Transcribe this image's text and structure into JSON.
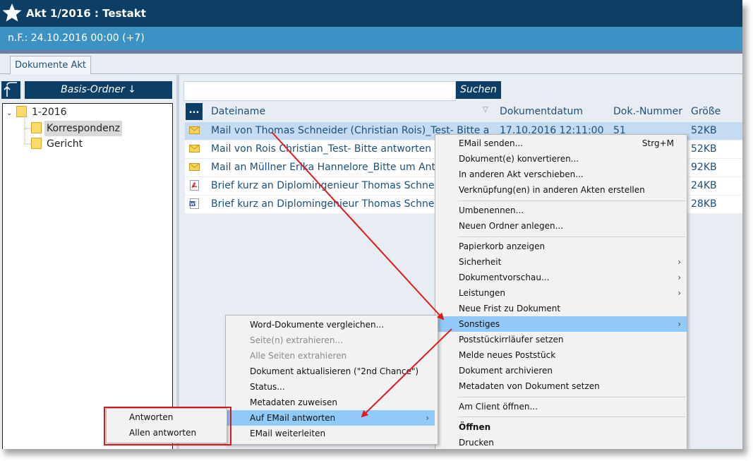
{
  "window": {
    "title": "Akt 1/2016 : Testakt",
    "subtitle": "n.F.: 24.10.2016 00:00 (+7)",
    "tab": "Dokumente Akt"
  },
  "left": {
    "basis_label": "Basis-Ordner ↓",
    "tree": [
      {
        "label": "1-2016",
        "expanded": true
      },
      {
        "label": "Korrespondenz",
        "selected": true
      },
      {
        "label": "Gericht"
      }
    ]
  },
  "search": {
    "value": "",
    "button": "Suchen"
  },
  "table": {
    "dots": "...",
    "columns": [
      "Dateiname",
      "Dokumentdatum",
      "Dok.-Nummer",
      "Größe"
    ],
    "rows": [
      {
        "icon": "email-icon",
        "name": "Mail von Thomas Schneider (Christian Rois)_Test- Bitte a",
        "date": "17.10.2016 12:11:00",
        "num": "51",
        "size": "52KB"
      },
      {
        "icon": "email-icon",
        "name": "Mail von Rois Christian_Test- Bitte antworten [",
        "date": "",
        "num": "",
        "size": "52KB"
      },
      {
        "icon": "email-icon",
        "name": "Mail an Müllner Erika Hannelore_Bitte um Ant",
        "date": "",
        "num": "",
        "size": "92KB"
      },
      {
        "icon": "pdf-icon",
        "name": "Brief kurz an Diplomingenieur Thomas Schnei",
        "date": "",
        "num": "",
        "size": "24KB"
      },
      {
        "icon": "word-icon",
        "name": "Brief kurz an Diplomingenieur Thomas Schnei",
        "date": "",
        "num": "",
        "size": "28KB"
      }
    ]
  },
  "context_menu": {
    "items": [
      {
        "label": "EMail senden...",
        "shortcut": "Strg+M"
      },
      {
        "label": "Dokument(e) konvertieren..."
      },
      {
        "label": "In anderen Akt verschieben..."
      },
      {
        "label": "Verknüpfung(en) in anderen Akten erstellen"
      },
      {
        "label": "Umbenennen..."
      },
      {
        "label": "Neuen Ordner anlegen..."
      },
      {
        "label": "Papierkorb anzeigen"
      },
      {
        "label": "Sicherheit",
        "submenu": true
      },
      {
        "label": "Dokumentvorschau...",
        "submenu": true
      },
      {
        "label": "Leistungen",
        "submenu": true
      },
      {
        "label": "Neue Frist zu Dokument"
      },
      {
        "label": "Sonstiges",
        "submenu": true,
        "highlighted": true
      },
      {
        "label": "Poststückirrläufer setzen"
      },
      {
        "label": "Melde neues Poststück"
      },
      {
        "label": "Dokument archivieren"
      },
      {
        "label": "Metadaten von Dokument setzen"
      },
      {
        "label": "Am Client öffnen..."
      },
      {
        "label": "Öffnen",
        "bold": true
      },
      {
        "label": "Drucken"
      }
    ]
  },
  "sonstiges_menu": {
    "items": [
      {
        "label": "Word-Dokumente vergleichen..."
      },
      {
        "label": "Seite(n) extrahieren...",
        "disabled": true
      },
      {
        "label": "Alle Seiten extrahieren",
        "disabled": true
      },
      {
        "label": "Dokument aktualisieren (\"2nd Chance\")"
      },
      {
        "label": "Status..."
      },
      {
        "label": "Metadaten zuweisen"
      },
      {
        "label": "Auf EMail antworten",
        "submenu": true,
        "highlighted": true
      },
      {
        "label": "EMail weiterleiten"
      }
    ]
  },
  "reply_menu": {
    "items": [
      {
        "label": "Antworten"
      },
      {
        "label": "Allen antworten"
      }
    ]
  },
  "colors": {
    "title_bar": "#0c3e66",
    "sub_bar": "#3d92c4",
    "highlight": "#91c9f7",
    "annotation": "#d9181b"
  }
}
